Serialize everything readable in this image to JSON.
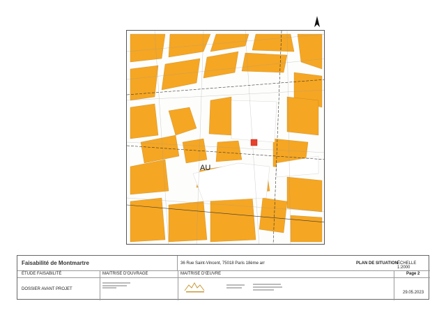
{
  "project": {
    "title": "Faisabilité de Montmartre",
    "address": "36 Rue Saint-Vincent, 75018 Paris 18ème arr",
    "plan_title": "PLAN DE SITUATION",
    "scale": "ÉCHELLE 1:2000",
    "phase": "ÉTUDE FAISABILITÉ",
    "document": "DOSSIER AVANT PROJET",
    "page": "Page 2",
    "date": "29.05.2023"
  },
  "roles": {
    "owner_label": "MAITRISE D'OUVRAGE",
    "architect_label": "MAITRISE D'ŒUVRE"
  },
  "map": {
    "zone_label": "AU",
    "colors": {
      "building": "#f5a623",
      "parcel_line": "#9a9a9a",
      "site": "#e8402a",
      "road": "#ffffff"
    }
  }
}
